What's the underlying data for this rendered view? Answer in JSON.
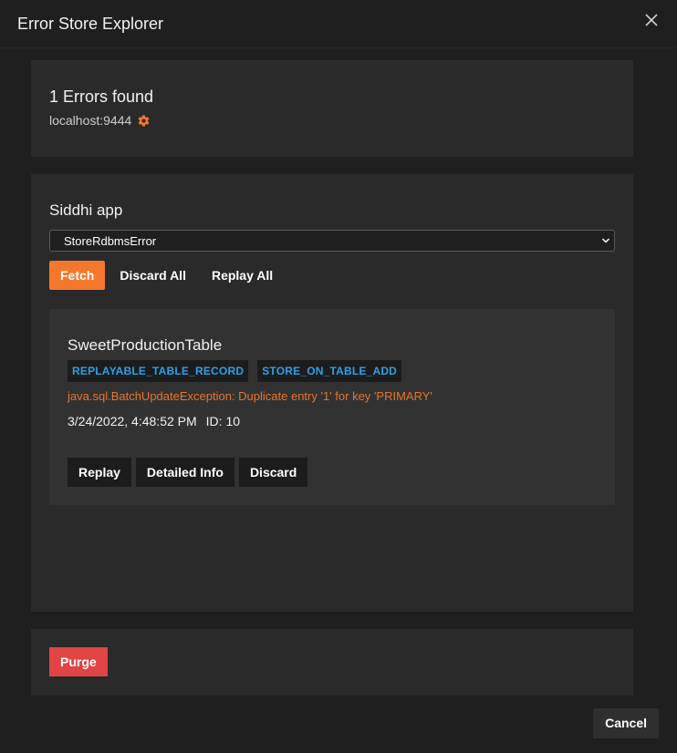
{
  "dialog": {
    "title": "Error Store Explorer",
    "close_icon": "close-icon"
  },
  "summary": {
    "errors_found": "1 Errors found",
    "host": "localhost:9444",
    "settings_icon": "gear-icon"
  },
  "app_selector": {
    "label": "Siddhi app",
    "selected": "StoreRdbmsError"
  },
  "actions": {
    "fetch_label": "Fetch",
    "discard_all_label": "Discard All",
    "replay_all_label": "Replay All"
  },
  "error_entry": {
    "title": "SweetProductionTable",
    "badges": [
      "REPLAYABLE_TABLE_RECORD",
      "STORE_ON_TABLE_ADD"
    ],
    "message": "java.sql.BatchUpdateException: Duplicate entry '1' for key 'PRIMARY'",
    "timestamp": "3/24/2022, 4:48:52 PM",
    "id_text": "ID: 10",
    "replay_label": "Replay",
    "detailed_info_label": "Detailed Info",
    "discard_label": "Discard"
  },
  "footer": {
    "purge_label": "Purge",
    "cancel_label": "Cancel"
  },
  "colors": {
    "accent": "#f5772b",
    "danger": "#e24444",
    "badge_text": "#2ea0e6",
    "error_text": "#e8742d"
  }
}
